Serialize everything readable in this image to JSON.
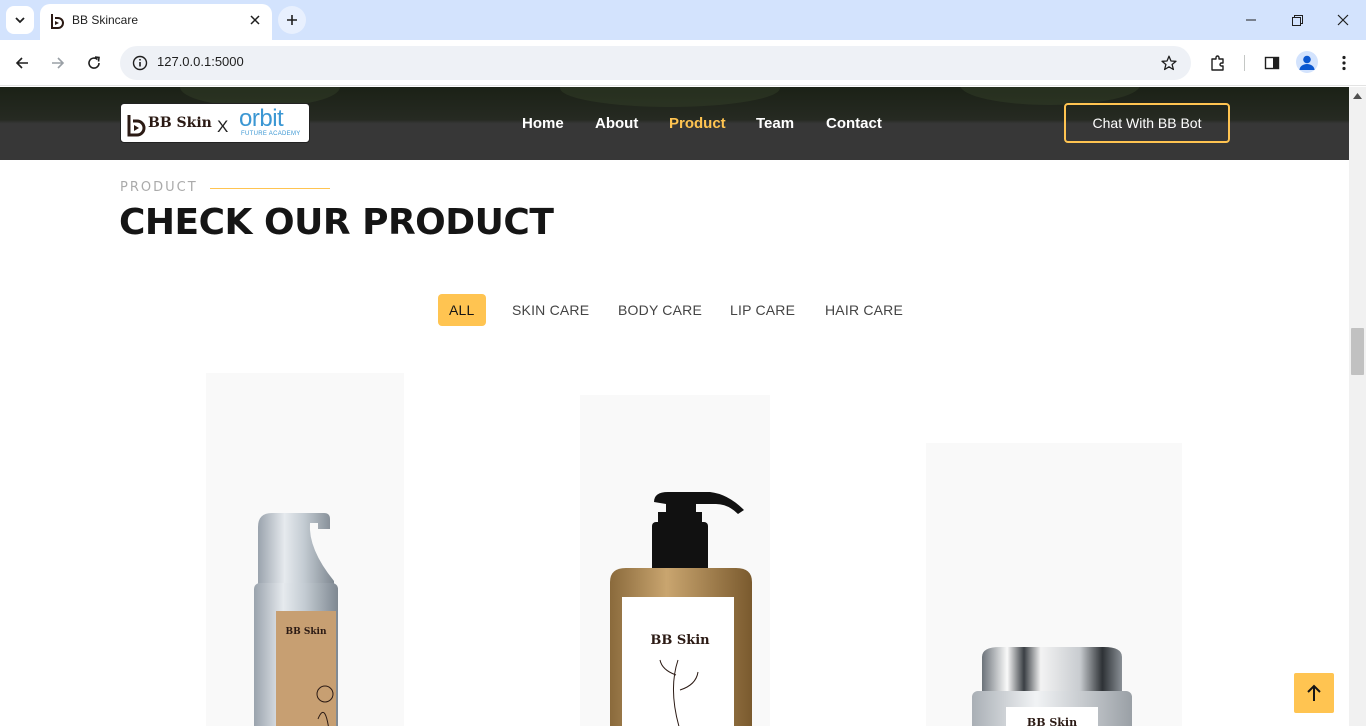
{
  "browser": {
    "tab_title": "BB Skincare",
    "url": "127.0.0.1:5000"
  },
  "header": {
    "logo_brand": "BB Skin",
    "logo_x": "X",
    "logo_partner": "orbit",
    "logo_partner_sub": "FUTURE ACADEMY",
    "nav": [
      {
        "label": "Home",
        "active": false
      },
      {
        "label": "About",
        "active": false
      },
      {
        "label": "Product",
        "active": true
      },
      {
        "label": "Team",
        "active": false
      },
      {
        "label": "Contact",
        "active": false
      }
    ],
    "cta_label": "Chat With BB Bot"
  },
  "section": {
    "kicker": "PRODUCT",
    "title": "CHECK OUR PRODUCT"
  },
  "filters": [
    {
      "label": "ALL",
      "active": true
    },
    {
      "label": "SKIN CARE",
      "active": false
    },
    {
      "label": "BODY CARE",
      "active": false
    },
    {
      "label": "LIP CARE",
      "active": false
    },
    {
      "label": "HAIR CARE",
      "active": false
    }
  ],
  "products": [
    {
      "label_brand": "BB Skin",
      "kind": "serum-bottle"
    },
    {
      "label_brand": "BB Skin",
      "kind": "pump-bottle"
    },
    {
      "label_brand": "BB Skin",
      "kind": "cream-jar"
    }
  ],
  "colors": {
    "accent": "#ffc451",
    "header_bg": "#373737",
    "title": "#151515"
  }
}
